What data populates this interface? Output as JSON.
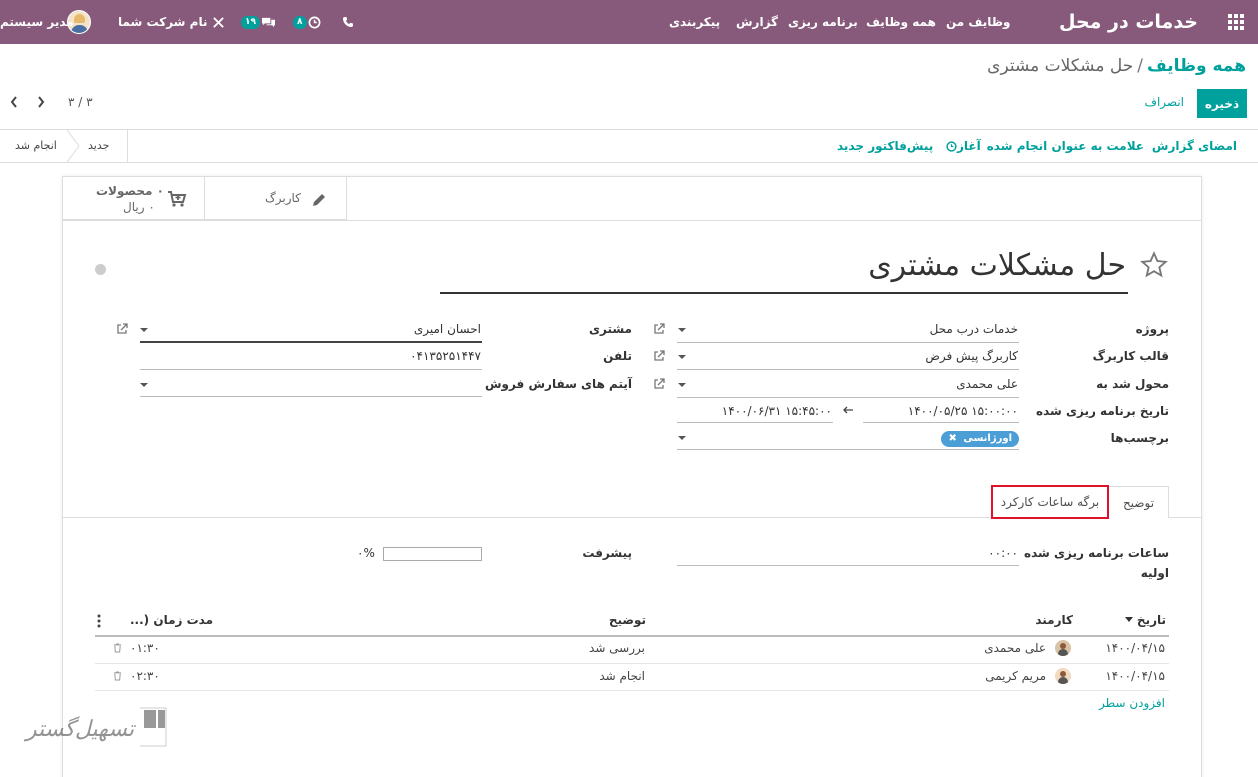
{
  "navbar": {
    "brand": "خدمات در محل",
    "menu": [
      "وظایف من",
      "همه وظایف",
      "برنامه ریزی",
      "گزارش",
      "پیکربندی"
    ],
    "activity_count": "۸",
    "messages_count": "۱۹",
    "company": "نام شرکت شما",
    "user": "مدیر سیستم",
    "bg_color": "#875a7b",
    "badge_color": "#00a09d"
  },
  "breadcrumb": {
    "parent": "همه وظایف",
    "separator": "/",
    "current": "حل مشکلات مشتری"
  },
  "actions": {
    "save": "ذخیره",
    "discard": "انصراف"
  },
  "pager": {
    "value": "۳ / ۳"
  },
  "status_bar": {
    "buttons": [
      "امضای گزارش",
      "علامت به عنوان انجام شده",
      "آغاز",
      "پیش‌فاکتور جدید"
    ],
    "stages": [
      "جدید",
      "انجام شد"
    ]
  },
  "smart_buttons": {
    "worksheet": "کاربرگ",
    "products_title": "۰ محصولات",
    "products_value": "۰ ریال"
  },
  "record": {
    "title": "حل مشکلات مشتری"
  },
  "fields": {
    "project": {
      "label": "پروژه",
      "value": "خدمات درب محل"
    },
    "template": {
      "label": "قالب کاربرگ",
      "value": "کاربرگ پیش فرض"
    },
    "assigned": {
      "label": "محول شد به",
      "value": "علی محمدی"
    },
    "planned": {
      "label": "تاریخ برنامه ریزی شده",
      "start": "۱۴۰۰/۰۵/۲۵ ۱۵:۰۰:۰۰",
      "end": "۱۴۰۰/۰۶/۳۱ ۱۵:۴۵:۰۰"
    },
    "tags": {
      "label": "برچسب‌ها",
      "value": "اورژانسی"
    },
    "customer": {
      "label": "مشتری",
      "value": "احسان امیری"
    },
    "phone": {
      "label": "تلفن",
      "value": "۰۴۱۳۵۲۵۱۴۴۷"
    },
    "so_items": {
      "label": "آیتم های سفارش فروش",
      "value": ""
    }
  },
  "tabs": {
    "description": "توضیح",
    "timesheet": "برگه ساعات کارکرد"
  },
  "timesheet": {
    "planned_label_1": "ساعات برنامه ریزی شده",
    "planned_label_2": "اولیه",
    "planned_value": "۰۰:۰۰",
    "progress_label": "پیشرفت",
    "progress_value": "۰%",
    "progress_fraction": 0,
    "columns": {
      "date": "تاریخ",
      "employee": "کارمند",
      "description": "توضیح",
      "duration": "مدت زمان (..."
    },
    "rows": [
      {
        "date": "۱۴۰۰/۰۴/۱۵",
        "employee": "علی محمدی",
        "description": "بررسی شد",
        "duration": "۰۱:۳۰"
      },
      {
        "date": "۱۴۰۰/۰۴/۱۵",
        "employee": "مریم کریمی",
        "description": "انجام شد",
        "duration": "۰۲:۳۰"
      }
    ],
    "add_line": "افزودن سطر"
  },
  "watermark": {
    "text": "تسهیل‌گستر"
  }
}
